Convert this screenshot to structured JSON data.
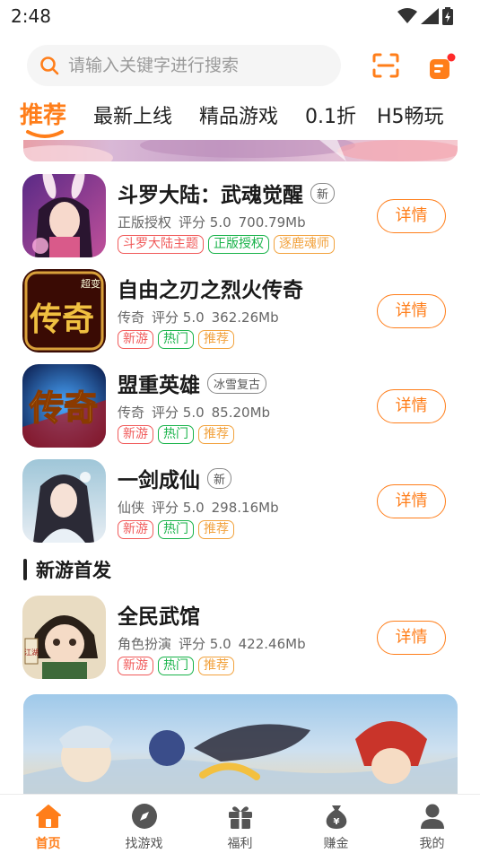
{
  "status_bar": {
    "time": "2:48"
  },
  "search": {
    "placeholder": "请输入关键字进行搜索"
  },
  "tabs": [
    {
      "label": "推荐"
    },
    {
      "label": "最新上线"
    },
    {
      "label": "精品游戏"
    },
    {
      "label": "0.1折"
    },
    {
      "label": "H5畅玩"
    }
  ],
  "games": [
    {
      "title": "斗罗大陆：武魂觉醒",
      "badge": "新",
      "category": "正版授权",
      "rating": "评分 5.0",
      "size": "700.79Mb",
      "tags": [
        "斗罗大陆主题",
        "正版授权",
        "逐鹿魂师"
      ],
      "button": "详情"
    },
    {
      "title": "自由之刃之烈火传奇",
      "badge": "",
      "category": "传奇",
      "rating": "评分 5.0",
      "size": "362.26Mb",
      "tags": [
        "新游",
        "热门",
        "推荐"
      ],
      "button": "详情"
    },
    {
      "title": "盟重英雄",
      "badge": "冰雪复古",
      "category": "传奇",
      "rating": "评分 5.0",
      "size": "85.20Mb",
      "tags": [
        "新游",
        "热门",
        "推荐"
      ],
      "button": "详情"
    },
    {
      "title": "一剑成仙",
      "badge": "新",
      "category": "仙侠",
      "rating": "评分 5.0",
      "size": "298.16Mb",
      "tags": [
        "新游",
        "热门",
        "推荐"
      ],
      "button": "详情"
    },
    {
      "title": "全民武馆",
      "badge": "",
      "category": "角色扮演",
      "rating": "评分 5.0",
      "size": "422.46Mb",
      "tags": [
        "新游",
        "热门",
        "推荐"
      ],
      "button": "详情"
    }
  ],
  "icon_text": {
    "chuanqi": "传奇",
    "chaobian": "超变",
    "jianghu": "江湖"
  },
  "section": {
    "title": "新游首发"
  },
  "bottom_nav": [
    {
      "label": "首页",
      "icon": "home-icon"
    },
    {
      "label": "找游戏",
      "icon": "compass-icon"
    },
    {
      "label": "福利",
      "icon": "gift-icon"
    },
    {
      "label": "赚金",
      "icon": "money-bag-icon"
    },
    {
      "label": "我的",
      "icon": "user-icon"
    }
  ],
  "colors": {
    "accent": "#ff7e1a",
    "tag_red": "#f05a5a",
    "tag_green": "#19b34a",
    "tag_orange": "#f2a23d"
  }
}
